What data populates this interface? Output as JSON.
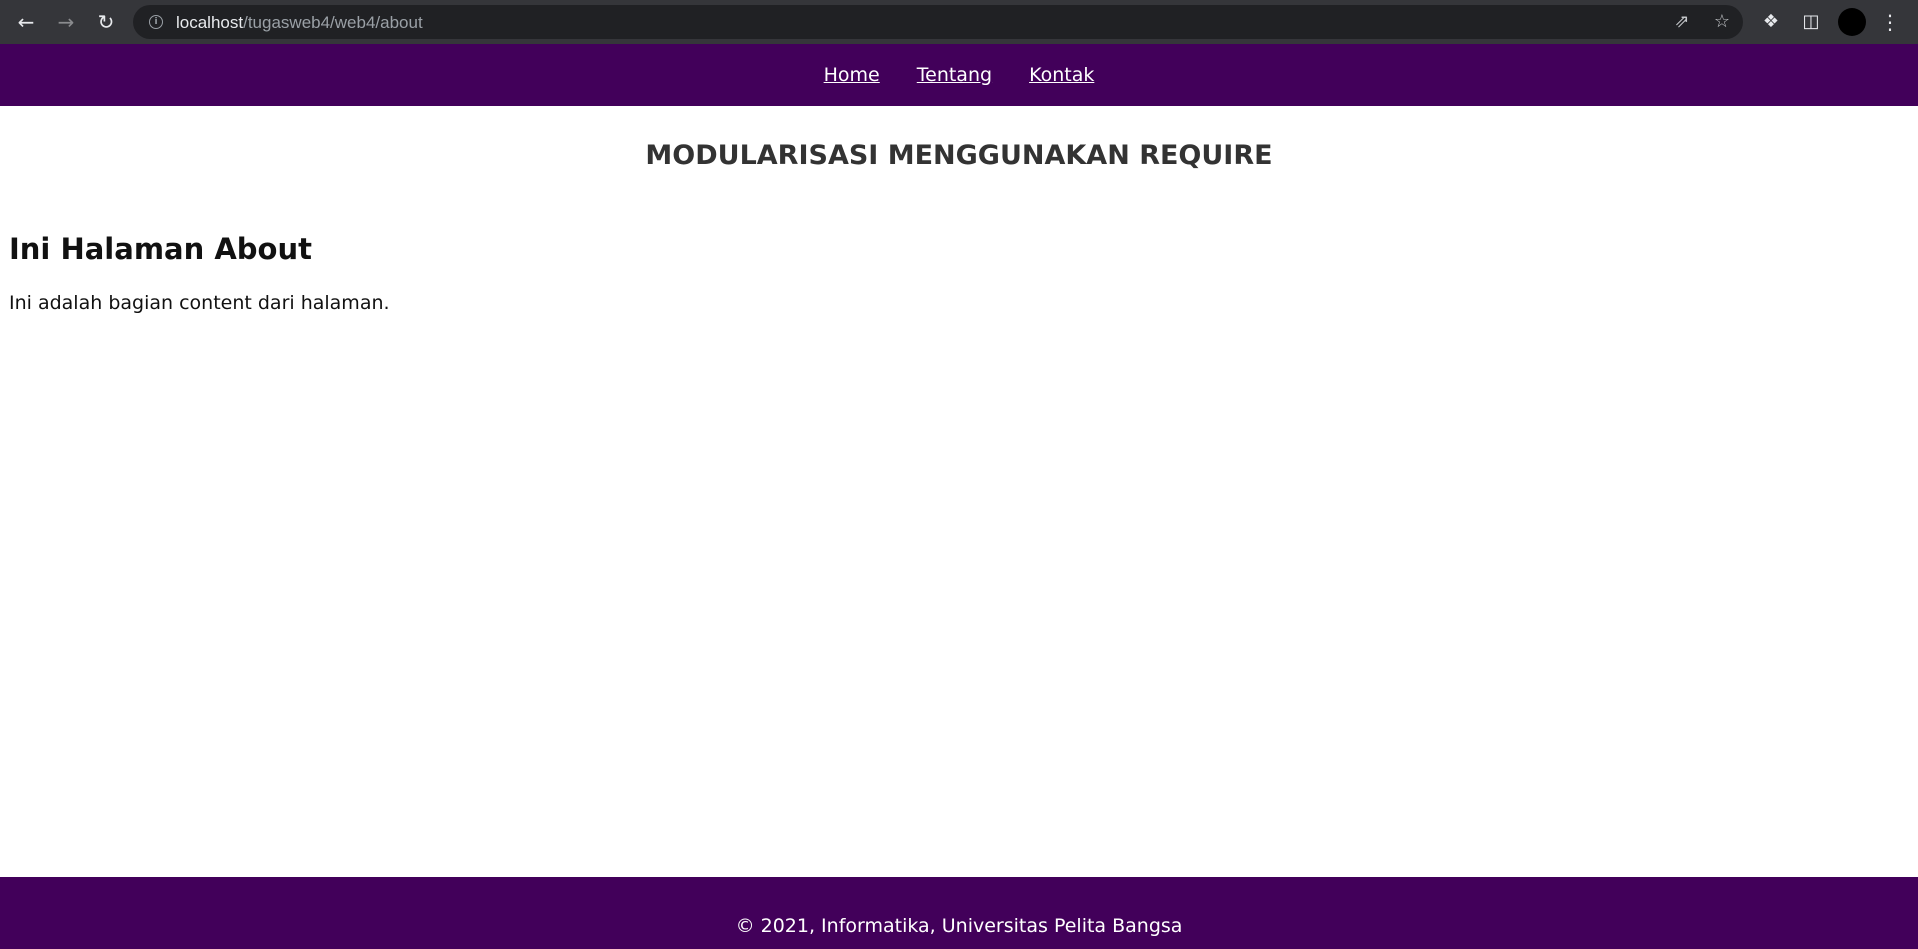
{
  "browser": {
    "url_host": "localhost",
    "url_path": "/tugasweb4/web4/about",
    "icons": {
      "back": "arrow-left-icon",
      "forward": "arrow-right-icon",
      "reload": "reload-icon",
      "site_info": "info-icon",
      "share": "share-icon",
      "bookmark": "star-icon",
      "extensions": "puzzle-icon",
      "side_panel": "side-panel-icon",
      "profile": "avatar",
      "menu": "more-vert-icon"
    }
  },
  "nav": {
    "items": [
      {
        "label": "Home"
      },
      {
        "label": "Tentang"
      },
      {
        "label": "Kontak"
      }
    ]
  },
  "header": {
    "title": "MODULARISASI MENGGUNAKAN REQUIRE"
  },
  "content": {
    "heading": "Ini Halaman About",
    "text": "Ini adalah bagian content dari halaman."
  },
  "footer": {
    "text": "© 2021, Informatika, Universitas Pelita Bangsa"
  },
  "colors": {
    "brand": "#42005a",
    "chrome_bar": "#35363a",
    "omnibox": "#202124"
  }
}
